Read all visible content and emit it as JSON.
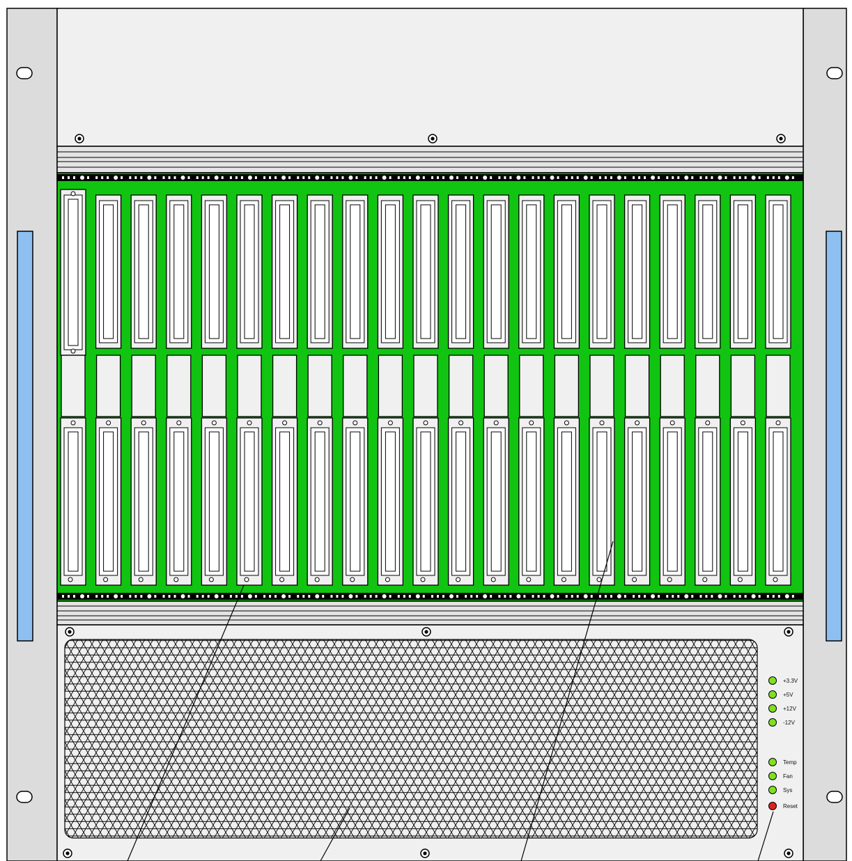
{
  "colors": {
    "backplane": "#12c412",
    "panel": "#f0f0f0",
    "ear": "#dcdcdc",
    "handle": "#8dc0f0",
    "led_ok": "#80e020",
    "led_reset": "#e02020",
    "outline": "#000000"
  },
  "chassis": {
    "slot_count": 21
  },
  "indicators": {
    "power": [
      {
        "label": "+3.3V",
        "status": "on"
      },
      {
        "label": "+5V",
        "status": "on"
      },
      {
        "label": "+12V",
        "status": "on"
      },
      {
        "label": "-12V",
        "status": "on"
      }
    ],
    "system": [
      {
        "label": "Temp",
        "status": "on"
      },
      {
        "label": "Fan",
        "status": "on"
      },
      {
        "label": "Sys",
        "status": "on"
      }
    ],
    "reset": {
      "label": "Reset",
      "status": "on"
    }
  }
}
